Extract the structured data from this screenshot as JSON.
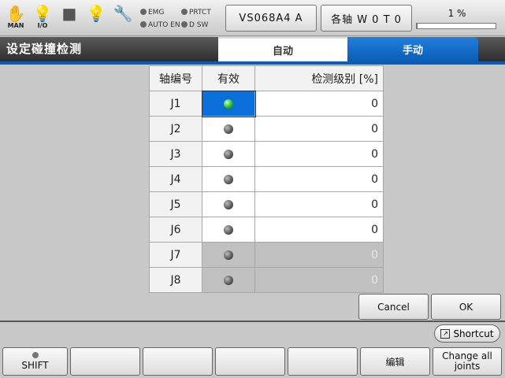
{
  "status": {
    "icons": [
      {
        "name": "man-hand-icon",
        "glyph": "✋",
        "label": "MAN"
      },
      {
        "name": "io-bulb-icon",
        "glyph": "💡",
        "label": "I/O"
      },
      {
        "name": "stop-square-icon",
        "glyph": "■",
        "label": ""
      },
      {
        "name": "lamp-icon",
        "glyph": "💡",
        "label": ""
      },
      {
        "name": "wrench-icon",
        "glyph": "🔧",
        "label": ""
      }
    ],
    "indicators": {
      "emg": "EMG",
      "prtct": "PRTCT",
      "auto_en": "AUTO EN",
      "dsw": "D SW"
    },
    "robot_label": "VS068A4 A",
    "coord_label": "各轴 W 0 T 0",
    "progress_text": "1 %",
    "progress_value": 1
  },
  "page_title": "设定碰撞检测",
  "tabs": {
    "auto": "自动",
    "manual": "手动"
  },
  "table": {
    "headers": [
      "轴编号",
      "有效",
      "检测级别 [%]"
    ],
    "rows": [
      {
        "axis": "J1",
        "enabled": true,
        "value": "0",
        "state": "selected"
      },
      {
        "axis": "J2",
        "enabled": false,
        "value": "0",
        "state": "normal"
      },
      {
        "axis": "J3",
        "enabled": false,
        "value": "0",
        "state": "normal"
      },
      {
        "axis": "J4",
        "enabled": false,
        "value": "0",
        "state": "normal"
      },
      {
        "axis": "J5",
        "enabled": false,
        "value": "0",
        "state": "normal"
      },
      {
        "axis": "J6",
        "enabled": false,
        "value": "0",
        "state": "normal"
      },
      {
        "axis": "J7",
        "enabled": false,
        "value": "0",
        "state": "disabled"
      },
      {
        "axis": "J8",
        "enabled": false,
        "value": "0",
        "state": "disabled"
      }
    ]
  },
  "buttons": {
    "cancel": "Cancel",
    "ok": "OK",
    "shortcut": "Shortcut"
  },
  "function_keys": [
    "SHIFT",
    "",
    "",
    "",
    "",
    "编辑",
    "Change all joints"
  ],
  "colors": {
    "accent": "#0a5db4",
    "enabled_led": "#2bbb2b",
    "disabled_led": "#555555"
  }
}
